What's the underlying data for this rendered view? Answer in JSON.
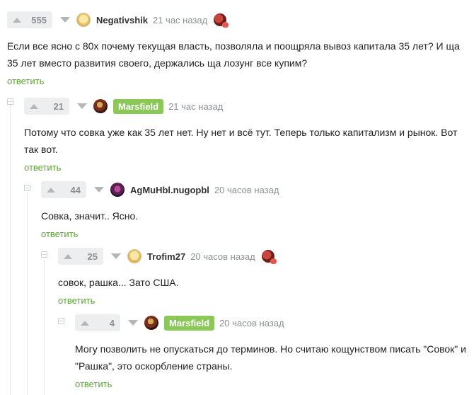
{
  "comments": [
    {
      "votes": "555",
      "username": "Negativshik",
      "time": "21 час назад",
      "text": "Если все ясно с 80х почему текущая власть, позволяла и поощряла вывоз капитала 35 лет? И ща 35 лет вместо развития своего, держались ща лозунг все купим?",
      "reply": "ответить",
      "avatar_icon": "user-avatar-icon",
      "badge_icon": "award-icon"
    },
    {
      "votes": "21",
      "username": "Marsfield",
      "author_tag": true,
      "time": "21 час назад",
      "text": "Потому что совка уже как 35 лет нет. Ну нет и всё тут. Теперь только капитализм и рынок. Вот так вот.",
      "reply": "ответить",
      "avatar_icon": "user-avatar-icon"
    },
    {
      "votes": "44",
      "username": "AgMuHbl.nugopbl",
      "time": "20 часов назад",
      "text": "Совка, значит.. Ясно.",
      "reply": "ответить",
      "avatar_icon": "user-avatar-icon"
    },
    {
      "votes": "25",
      "username": "Trofim27",
      "time": "20 часов назад",
      "text": "совок, рашка... Зато США.",
      "reply": "ответить",
      "avatar_icon": "user-avatar-icon",
      "badge_icon": "award-icon"
    },
    {
      "votes": "4",
      "username": "Marsfield",
      "author_tag": true,
      "time": "20 часов назад",
      "text": "Могу позволить не опускаться до терминов. Но считаю кощунством писать \"Совок\" и \"Рашка\", это оскорбление страны.",
      "reply": "ответить",
      "avatar_icon": "user-avatar-icon"
    }
  ],
  "colors": {
    "accent_green": "#8ac858",
    "reply_green": "#5ba335",
    "muted": "#8c8f93"
  }
}
